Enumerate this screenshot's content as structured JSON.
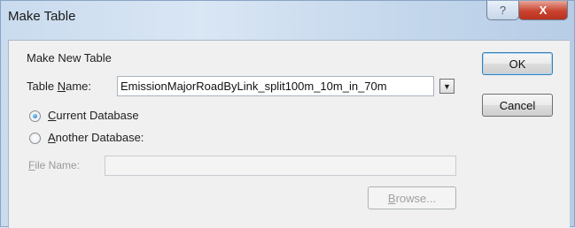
{
  "window": {
    "title": "Make Table",
    "help_glyph": "?",
    "close_glyph": "X"
  },
  "form": {
    "group_label": "Make New Table",
    "table_name_label_pre": "Table ",
    "table_name_label_underline": "N",
    "table_name_label_post": "ame:",
    "table_name_value": "EmissionMajorRoadByLink_split100m_10m_in_70m",
    "dropdown_glyph": "▼",
    "current_db_underline": "C",
    "current_db_rest": "urrent Database",
    "current_db_selected": true,
    "another_db_underline": "A",
    "another_db_rest": "nother Database:",
    "file_name_underline": "F",
    "file_name_rest": "ile Name:",
    "file_name_value": ""
  },
  "buttons": {
    "ok": "OK",
    "cancel": "Cancel",
    "browse_underline": "B",
    "browse_rest": "rowse..."
  }
}
